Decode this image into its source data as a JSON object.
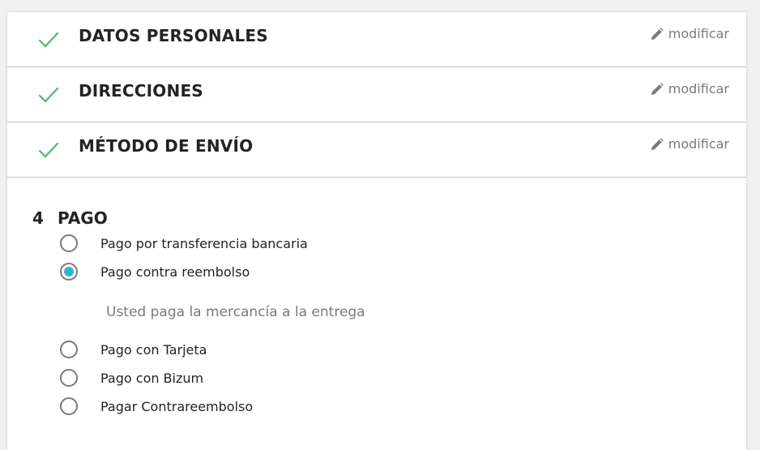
{
  "steps": [
    {
      "title": "DATOS PERSONALES",
      "edit_label": "modificar"
    },
    {
      "title": "DIRECCIONES",
      "edit_label": "modificar"
    },
    {
      "title": "MÉTODO DE ENVÍO",
      "edit_label": "modificar"
    }
  ],
  "payment": {
    "number": "4",
    "title": "PAGO",
    "options": [
      {
        "label": "Pago por transferencia bancaria",
        "selected": false
      },
      {
        "label": "Pago contra reembolso",
        "selected": true
      },
      {
        "label": "Pago con Tarjeta",
        "selected": false
      },
      {
        "label": "Pago con Bizum",
        "selected": false
      },
      {
        "label": "Pagar Contrareembolso",
        "selected": false
      }
    ],
    "info_text": "Usted paga la mercancía a la entrega"
  },
  "colors": {
    "check": "#4cbb6c",
    "radio_selected": "#2fb5d2",
    "muted_text": "#7a7a7a"
  },
  "icons": {
    "step_done": "check-icon",
    "edit": "pencil-icon"
  }
}
